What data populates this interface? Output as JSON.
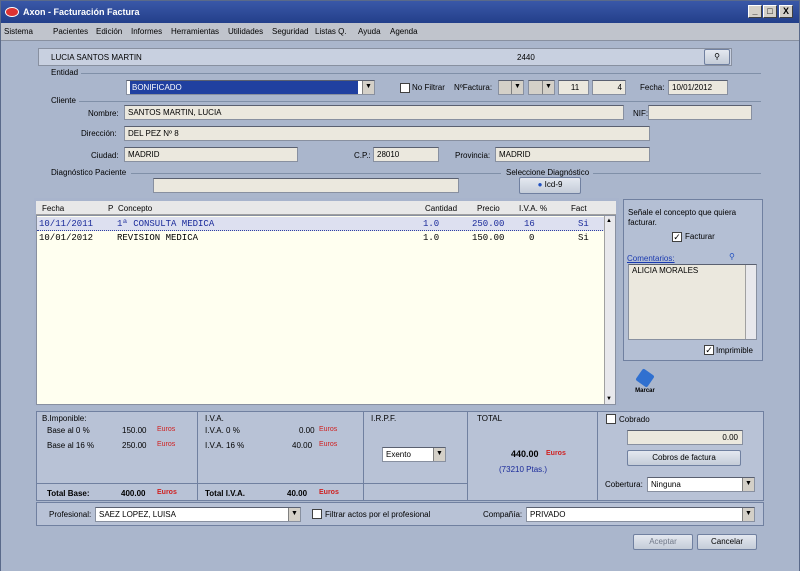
{
  "window": {
    "title": "Axon - Facturación Factura",
    "min": "_",
    "max": "□",
    "close": "X"
  },
  "menu": [
    "Sistema",
    "Pacientes",
    "Edición",
    "Informes",
    "Herramientas",
    "Utilidades",
    "Seguridad",
    "Listas Q.",
    "Ayuda",
    "Agenda"
  ],
  "header": {
    "patient_name": "LUCIA SANTOS MARTIN",
    "code": "2440"
  },
  "entidad": {
    "section": "Entidad",
    "value": "BONIFICADO",
    "no_filtrar": "No Filtrar",
    "nfactura_label": "NºFactura:",
    "nfactura_a": "11",
    "nfactura_b": "4",
    "fecha_label": "Fecha:",
    "fecha": "10/01/2012"
  },
  "cliente": {
    "section": "Cliente",
    "nombre_label": "Nombre:",
    "nombre": "SANTOS MARTIN, LUCIA",
    "nif_label": "NIF:",
    "nif": "",
    "direccion_label": "Dirección:",
    "direccion": "DEL PEZ Nº 8",
    "ciudad_label": "Ciudad:",
    "ciudad": "MADRID",
    "cp_label": "C.P.:",
    "cp": "28010",
    "provincia_label": "Provincia:",
    "provincia": "MADRID"
  },
  "diagnostico": {
    "section": "Diagnóstico Paciente",
    "seleccione": "Seleccione Diagnóstico",
    "btn": "Icd-9",
    "value": ""
  },
  "grid": {
    "headers": {
      "fecha": "Fecha",
      "p": "P",
      "concepto": "Concepto",
      "cantidad": "Cantidad",
      "precio": "Precio",
      "iva": "I.V.A. %",
      "fact": "Fact"
    },
    "rows": [
      {
        "fecha": "10/11/2011",
        "concepto": "1ª CONSULTA MEDICA",
        "cantidad": "1.0",
        "precio": "250.00",
        "iva": "16",
        "fact": "Si"
      },
      {
        "fecha": "10/01/2012",
        "concepto": "REVISION MEDICA",
        "cantidad": "1.0",
        "precio": "150.00",
        "iva": "0",
        "fact": "Si"
      }
    ]
  },
  "side": {
    "hint": "Señale el concepto que quiera facturar.",
    "facturar": "Facturar",
    "comentarios_label": "Comentarios:",
    "comentarios": "ALICIA MORALES",
    "imprimible": "Imprimible",
    "marcar": "Marcar"
  },
  "totals": {
    "bimp_title": "B.Imponible:",
    "base0_label": "Base al 0 %",
    "base0": "150.00",
    "base16_label": "Base al 16 %",
    "base16": "250.00",
    "euros": "Euros",
    "iva_title": "I.V.A.",
    "iva0_label": "I.V.A. 0 %",
    "iva0": "0.00",
    "iva16_label": "I.V.A. 16 %",
    "iva16": "40.00",
    "irpf_title": "I.R.P.F.",
    "irpf": "Exento",
    "total_title": "TOTAL",
    "total": "440.00",
    "pts": "(73210  Ptas.)",
    "total_base_label": "Total Base:",
    "total_base": "400.00",
    "total_iva_label": "Total I.V.A.",
    "total_iva": "40.00",
    "cobrado": "Cobrado",
    "cobrado_val": "0.00",
    "cobros_btn": "Cobros de factura",
    "cobertura_label": "Cobertura:",
    "cobertura": "Ninguna"
  },
  "footer": {
    "profesional_label": "Profesional:",
    "profesional": "SAEZ LOPEZ, LUISA",
    "filtrar": "Filtrar actos por el profesional",
    "compania_label": "Compañía:",
    "compania": "PRIVADO",
    "aceptar": "Aceptar",
    "cancelar": "Cancelar"
  }
}
